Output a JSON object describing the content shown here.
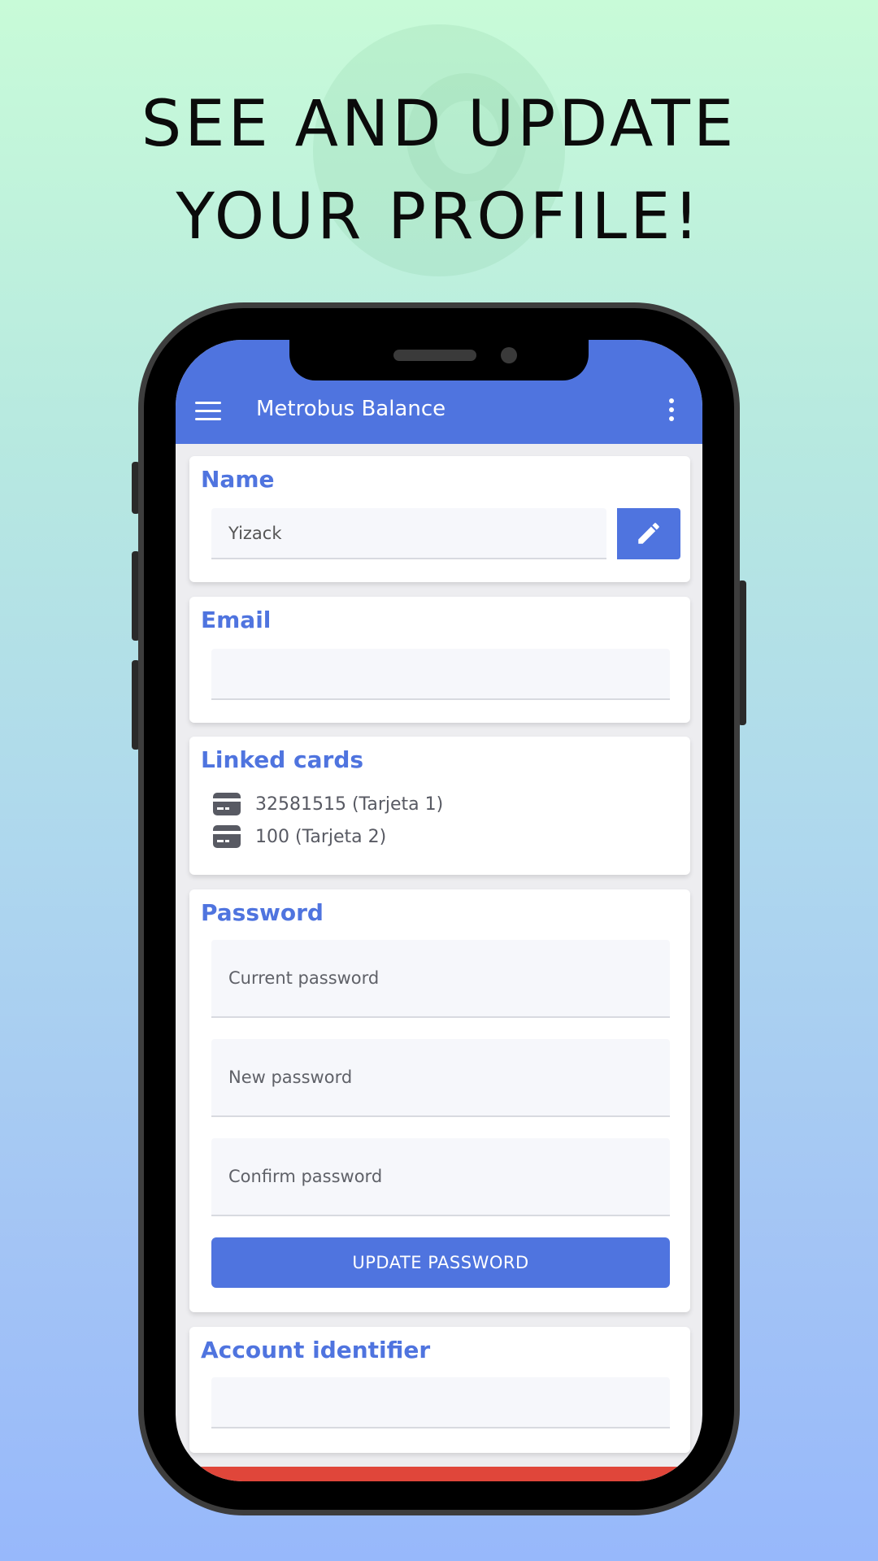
{
  "headline": {
    "line1": "SEE AND UPDATE",
    "line2": "YOUR PROFILE!"
  },
  "appbar": {
    "title": "Metrobus Balance",
    "menu_icon": "hamburger-menu-icon",
    "more_icon": "more-vertical-icon"
  },
  "profile": {
    "name": {
      "title": "Name",
      "value": "Yizack",
      "edit_icon": "pencil-icon"
    },
    "email": {
      "title": "Email",
      "value": ""
    },
    "linked_cards": {
      "title": "Linked cards",
      "items": [
        {
          "label": "32581515 (Tarjeta 1)",
          "icon": "credit-card-icon"
        },
        {
          "label": "100 (Tarjeta 2)",
          "icon": "credit-card-icon"
        }
      ]
    },
    "password": {
      "title": "Password",
      "current_placeholder": "Current password",
      "new_placeholder": "New password",
      "confirm_placeholder": "Confirm password",
      "update_label": "UPDATE PASSWORD"
    },
    "account": {
      "title": "Account identifier",
      "value": ""
    }
  },
  "colors": {
    "accent": "#4f74df",
    "danger": "#e0463a",
    "card_text": "#585a63"
  }
}
